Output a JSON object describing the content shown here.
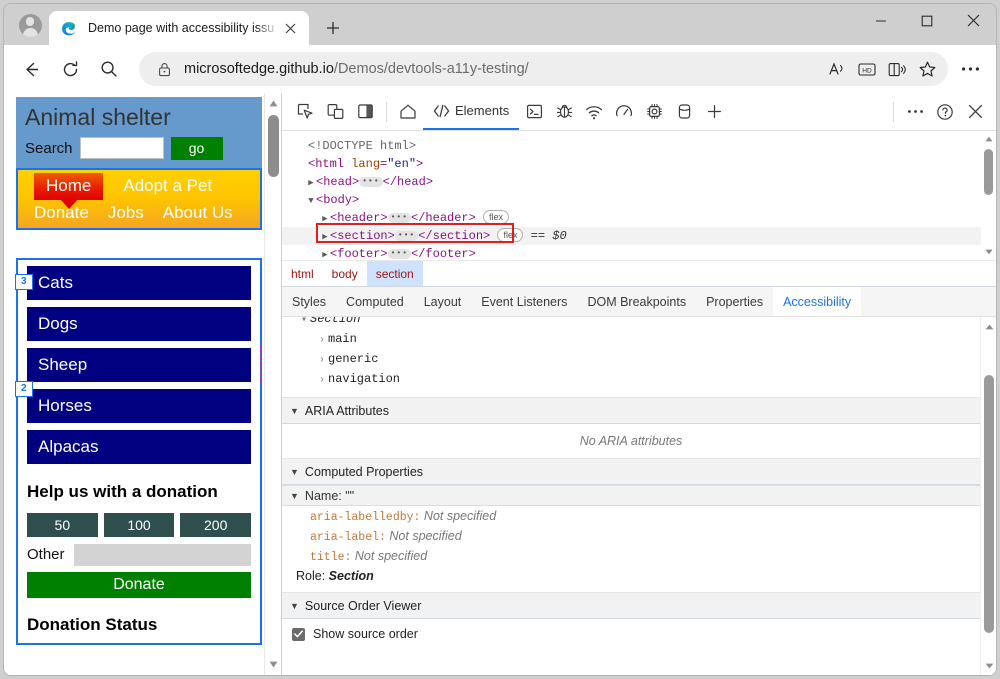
{
  "browser": {
    "tab": {
      "title": "Demo page with accessibility issu",
      "favicon": "edge-logo-icon",
      "close": "×"
    },
    "newtab_label": "+",
    "window_controls": {
      "minimize": "minimize-icon",
      "maximize": "maximize-icon",
      "close": "close-icon"
    },
    "nav": {
      "back": "back-arrow-icon",
      "refresh": "refresh-icon",
      "search": "search-icon"
    },
    "omnibox": {
      "lock": "lock-icon",
      "url_main": "microsoftedge.github.io",
      "url_path": "/Demos/devtools-a11y-testing/",
      "icons": [
        "read-aloud-icon",
        "hd-badge-icon",
        "immersive-reader-icon",
        "favorites-star-icon"
      ]
    },
    "more_label": "…"
  },
  "page": {
    "header": {
      "title": "Animal shelter",
      "search_label": "Search",
      "search_value": "",
      "go_label": "go"
    },
    "nav": {
      "primary": [
        "Home",
        "Adopt a Pet"
      ],
      "secondary": [
        "Donate",
        "Jobs",
        "About Us"
      ],
      "active": "Home"
    },
    "categories": [
      "Cats",
      "Dogs",
      "Sheep",
      "Horses",
      "Alpacas"
    ],
    "donation": {
      "heading": "Help us with a donation",
      "amounts": [
        "50",
        "100",
        "200"
      ],
      "other_label": "Other",
      "other_value": "",
      "donate_label": "Donate"
    },
    "status_heading": "Donation Status",
    "source_order_badges": [
      "3",
      "2"
    ],
    "colors": {
      "header_bg": "#6699cc",
      "nav_bg": "#ffc500",
      "home_bg": "#e00000",
      "category_bg": "#000080",
      "donate_bg": "#008000",
      "amount_bg": "#2f4f4f",
      "outline_blue": "#1a73e8",
      "outline_pink": "#e0218a"
    }
  },
  "devtools": {
    "toolbar": {
      "left_icons": [
        "inspect-element-icon",
        "device-emulation-icon",
        "dock-side-icon"
      ],
      "home_icon": "home-icon",
      "tabs": [
        {
          "label": "Elements",
          "icon": "code-brackets-icon",
          "active": true
        }
      ],
      "more_icons": [
        "console-icon",
        "debugger-icon",
        "network-icon",
        "performance-icon",
        "settings-gear-icon",
        "application-icon",
        "add-tab-icon"
      ],
      "right_icons": [
        "more-options-icon",
        "help-icon",
        "close-devtools-icon"
      ]
    },
    "dom": {
      "lines": [
        {
          "indent": 0,
          "caret": "",
          "text": "<!DOCTYPE html>",
          "type": "doctype"
        },
        {
          "indent": 0,
          "caret": "",
          "text": "<html lang=\"en\">",
          "type": "open-tag",
          "tag": "html",
          "attr": "lang",
          "value": "\"en\""
        },
        {
          "indent": 1,
          "caret": "▶",
          "tag": "head",
          "type": "collapsed"
        },
        {
          "indent": 1,
          "caret": "▼",
          "tag": "body",
          "type": "open-tag-only"
        },
        {
          "indent": 2,
          "caret": "▶",
          "tag": "header",
          "type": "collapsed",
          "badge": "flex"
        },
        {
          "indent": 2,
          "caret": "▶",
          "tag": "section",
          "type": "collapsed",
          "badge": "flex",
          "selected": true,
          "suffix": "== $0"
        },
        {
          "indent": 2,
          "caret": "▶",
          "tag": "footer",
          "type": "collapsed"
        }
      ],
      "gutter_dots": "•••"
    },
    "breadcrumb": [
      {
        "label": "html",
        "active": false
      },
      {
        "label": "body",
        "active": false
      },
      {
        "label": "section",
        "active": true
      }
    ],
    "subtabs": [
      {
        "label": "Styles",
        "active": false
      },
      {
        "label": "Computed",
        "active": false
      },
      {
        "label": "Layout",
        "active": false
      },
      {
        "label": "Event Listeners",
        "active": false
      },
      {
        "label": "DOM Breakpoints",
        "active": false
      },
      {
        "label": "Properties",
        "active": false
      },
      {
        "label": "Accessibility",
        "active": true
      }
    ],
    "accessibility": {
      "tree": [
        {
          "indent": 0,
          "caret": "▾",
          "label": "Section",
          "italic": true
        },
        {
          "indent": 1,
          "caret": "›",
          "label": "main",
          "italic": false
        },
        {
          "indent": 1,
          "caret": "›",
          "label": "generic",
          "italic": false
        },
        {
          "indent": 1,
          "caret": "›",
          "label": "navigation",
          "italic": false
        }
      ],
      "aria_section": {
        "title": "ARIA Attributes",
        "empty_text": "No ARIA attributes"
      },
      "computed_section": {
        "title": "Computed Properties",
        "name_row": "Name: \"\"",
        "properties": [
          {
            "key": "aria-labelledby",
            "value": "Not specified"
          },
          {
            "key": "aria-label",
            "value": "Not specified"
          },
          {
            "key": "title",
            "value": "Not specified"
          }
        ],
        "role_label": "Role:",
        "role_value": "Section"
      },
      "source_order_section": {
        "title": "Source Order Viewer",
        "checkbox_label": "Show source order",
        "checked": true
      }
    }
  }
}
